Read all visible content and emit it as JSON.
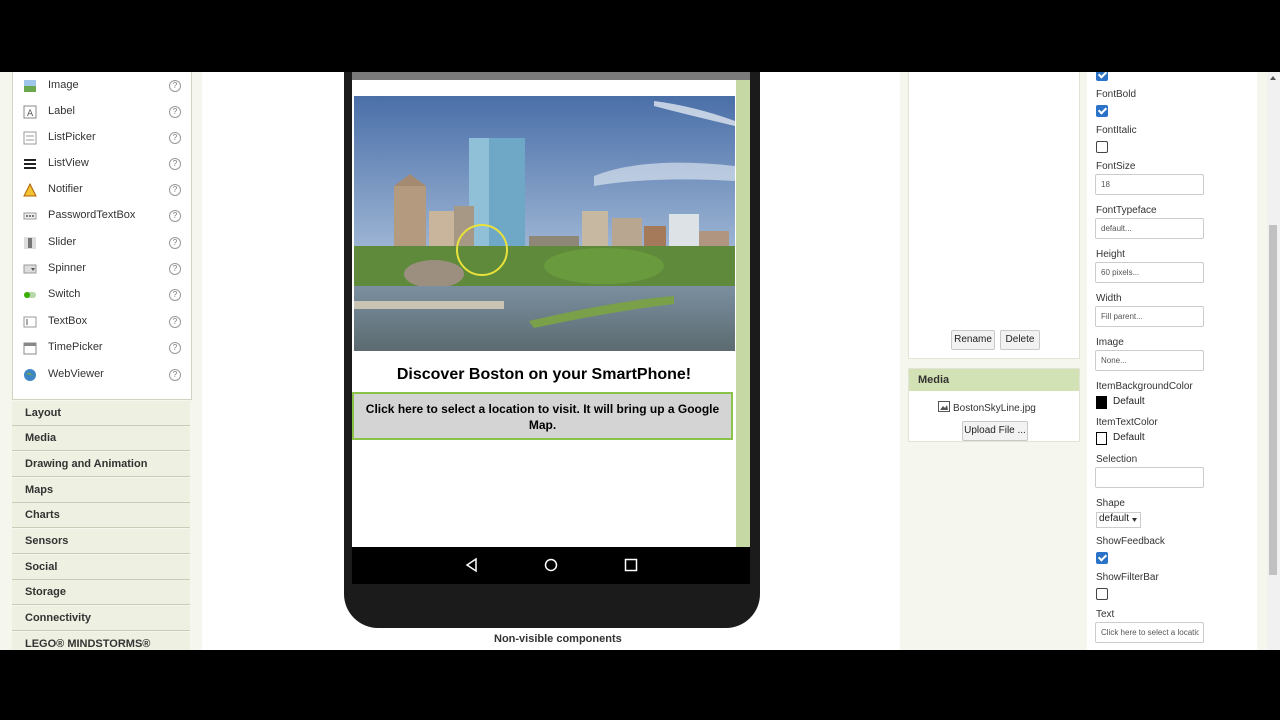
{
  "palette": {
    "items": [
      {
        "label": "Image",
        "icon": "image-icon"
      },
      {
        "label": "Label",
        "icon": "label-icon"
      },
      {
        "label": "ListPicker",
        "icon": "listpicker-icon"
      },
      {
        "label": "ListView",
        "icon": "listview-icon"
      },
      {
        "label": "Notifier",
        "icon": "notifier-icon"
      },
      {
        "label": "PasswordTextBox",
        "icon": "password-icon"
      },
      {
        "label": "Slider",
        "icon": "slider-icon"
      },
      {
        "label": "Spinner",
        "icon": "spinner-icon"
      },
      {
        "label": "Switch",
        "icon": "switch-icon"
      },
      {
        "label": "TextBox",
        "icon": "textbox-icon"
      },
      {
        "label": "TimePicker",
        "icon": "timepicker-icon"
      },
      {
        "label": "WebViewer",
        "icon": "webviewer-icon"
      }
    ],
    "help_glyph": "?",
    "categories": [
      "Layout",
      "Media",
      "Drawing and Animation",
      "Maps",
      "Charts",
      "Sensors",
      "Social",
      "Storage",
      "Connectivity",
      "LEGO® MINDSTORMS®"
    ]
  },
  "viewer": {
    "title": "Discover Boston on your SmartPhone!",
    "button_text": "Click here to select a location to visit. It will bring up a Google Map.",
    "non_visible": "Non-visible components"
  },
  "components": {
    "rename": "Rename",
    "delete": "Delete"
  },
  "media": {
    "header": "Media",
    "file": "BostonSkyLine.jpg",
    "upload": "Upload File ..."
  },
  "properties": {
    "fontbold": {
      "label": "FontBold",
      "checked": true
    },
    "fontitalic": {
      "label": "FontItalic",
      "checked": false
    },
    "fontsize": {
      "label": "FontSize",
      "value": "18"
    },
    "fonttypeface": {
      "label": "FontTypeface",
      "value": "default..."
    },
    "height": {
      "label": "Height",
      "value": "60 pixels..."
    },
    "width": {
      "label": "Width",
      "value": "Fill parent..."
    },
    "image": {
      "label": "Image",
      "value": "None..."
    },
    "itembg": {
      "label": "ItemBackgroundColor",
      "value": "Default",
      "color": "#000000"
    },
    "itemtext": {
      "label": "ItemTextColor",
      "value": "Default",
      "color": "#ffffff"
    },
    "selection": {
      "label": "Selection",
      "value": ""
    },
    "shape": {
      "label": "Shape",
      "value": "default"
    },
    "showfeedback": {
      "label": "ShowFeedback",
      "checked": true
    },
    "showfilterbar": {
      "label": "ShowFilterBar",
      "checked": false
    },
    "text": {
      "label": "Text",
      "value": "Click here to select a location to visit"
    }
  },
  "colors": {
    "accent_green": "#8bc34a",
    "media_header": "#d3e2b4",
    "checkbox_blue": "#2a73c8"
  }
}
